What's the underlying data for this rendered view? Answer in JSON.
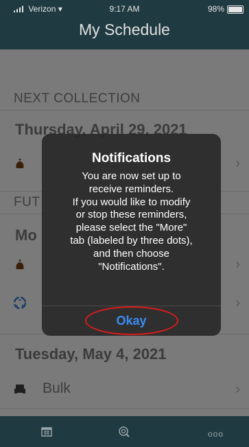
{
  "status_bar": {
    "carrier": "Verizon",
    "time": "9:17 AM",
    "battery": "98%"
  },
  "header": {
    "title": "My Schedule"
  },
  "schedule": {
    "next_collection_label": "NEXT COLLECTION",
    "next_date": "Thursday, April 29, 2021",
    "future_label_visible": "FUT",
    "future_date_visible": "Mo",
    "may4_date": "Tuesday, May 4, 2021",
    "may4_item": "Bulk"
  },
  "modal": {
    "title": "Notifications",
    "message_lines": [
      "You are now set up to",
      "receive reminders.",
      "If you would like to modify",
      "or stop these reminders,",
      "please select the \"More\"",
      "tab (labeled by three dots),",
      "and then choose",
      "\"Notifications\"."
    ],
    "ok_label": "Okay"
  },
  "tabbar": {
    "more_label": "ooo"
  },
  "colors": {
    "header_bg": "#1f3a41",
    "accent_blue": "#3b8cf2",
    "annotation_red": "#e11b1b"
  }
}
